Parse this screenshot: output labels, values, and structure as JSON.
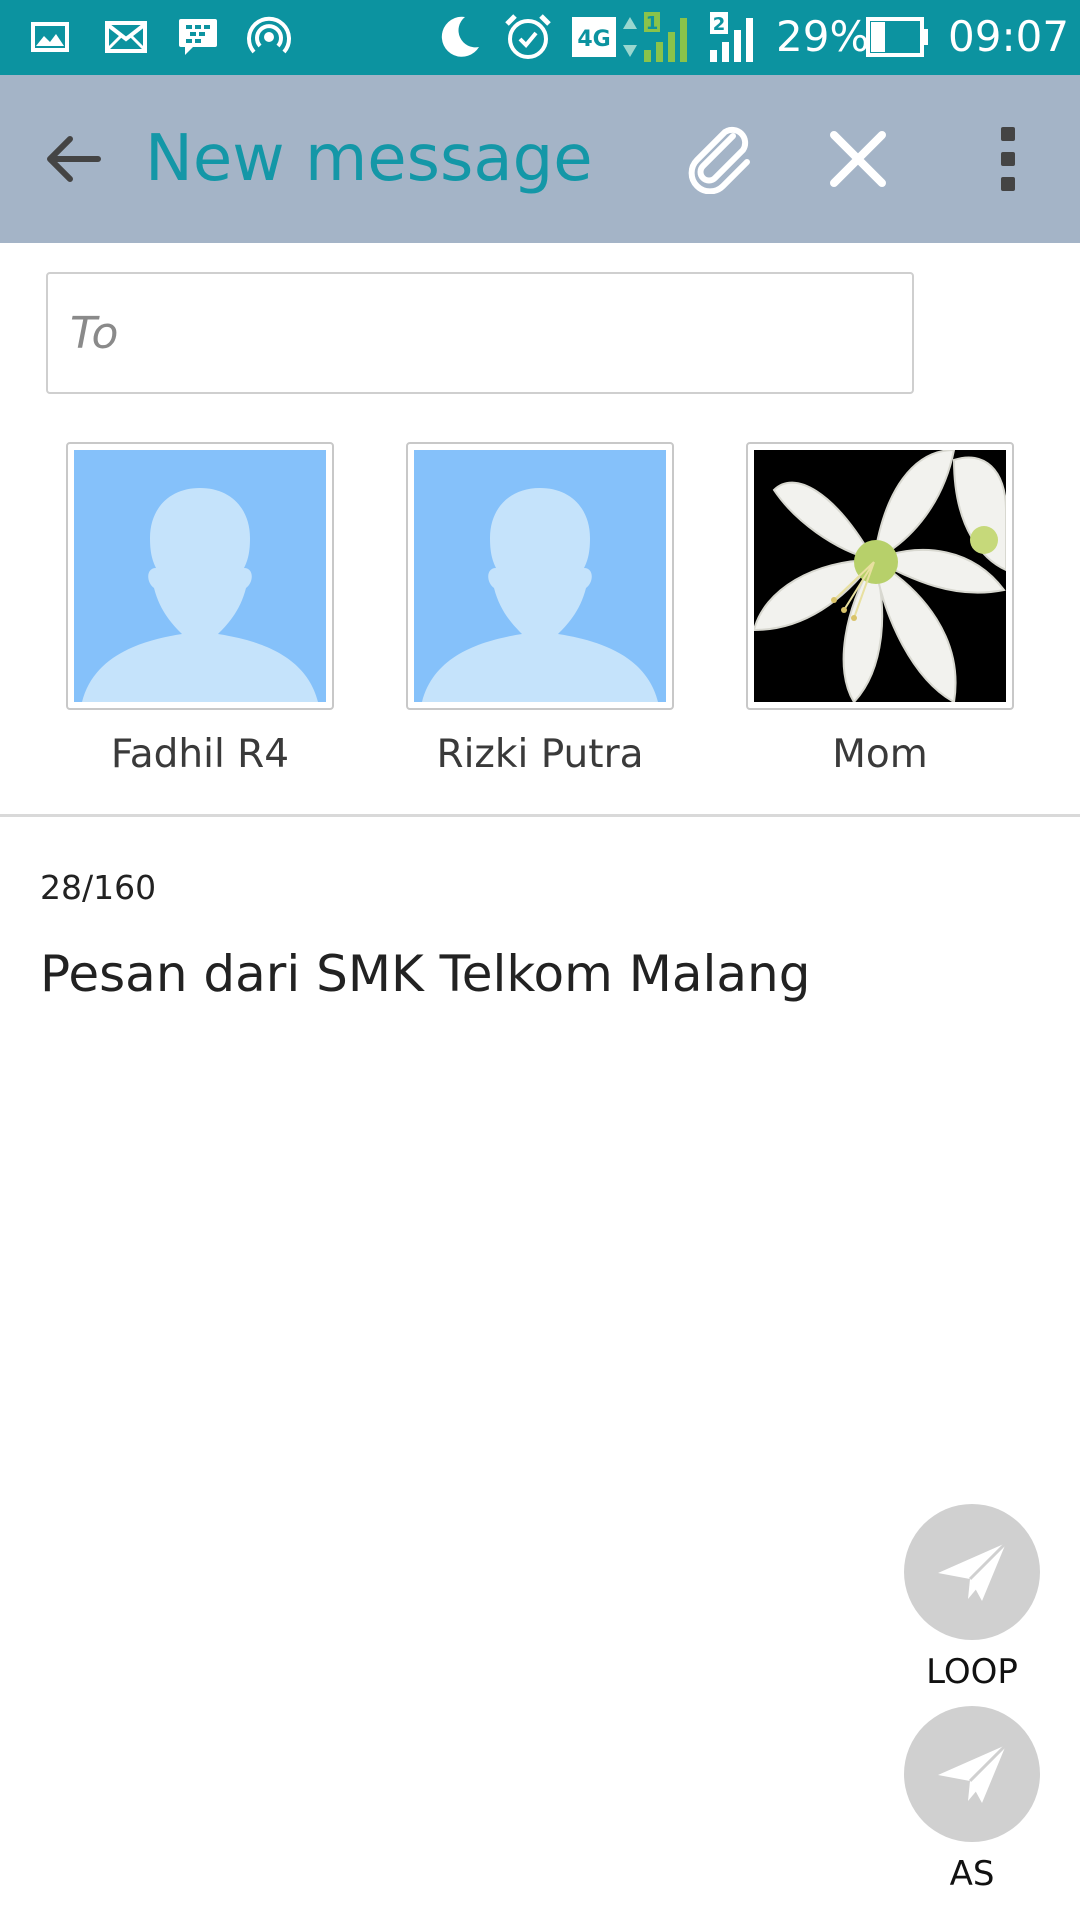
{
  "status_bar": {
    "battery_percent": "29%",
    "time": "09:07",
    "network_type": "4G",
    "sim1_label": "1",
    "sim2_label": "2",
    "battery_level": 0.29,
    "icons": [
      "gallery-icon",
      "email-icon",
      "bbm-icon",
      "hotspot-icon",
      "moon-icon",
      "alarm-icon",
      "network-4g-icon",
      "signal-sim1-icon",
      "signal-sim2-icon",
      "battery-icon"
    ]
  },
  "toolbar": {
    "title": "New message",
    "icons": [
      "back-arrow-icon",
      "paperclip-icon",
      "close-icon",
      "more-vert-icon"
    ]
  },
  "compose": {
    "to_placeholder": "To",
    "to_value": "",
    "char_count": "28/160",
    "message": "Pesan dari SMK Telkom Malang"
  },
  "contacts": [
    {
      "name": "Fadhil R4",
      "photo": "default-avatar"
    },
    {
      "name": "Rizki Putra",
      "photo": "default-avatar"
    },
    {
      "name": "Mom",
      "photo": "white-lily-photo"
    }
  ],
  "send_buttons": [
    {
      "label": "LOOP",
      "icon": "send-icon"
    },
    {
      "label": "AS",
      "icon": "send-icon"
    }
  ],
  "colors": {
    "status_bar": "#0c93a0",
    "toolbar": "#a4b4c7",
    "title": "#1497a7",
    "avatar_bg": "#85c1fa",
    "avatar_silhouette": "#c5e3fb",
    "send_button": "#d0d0d0"
  }
}
